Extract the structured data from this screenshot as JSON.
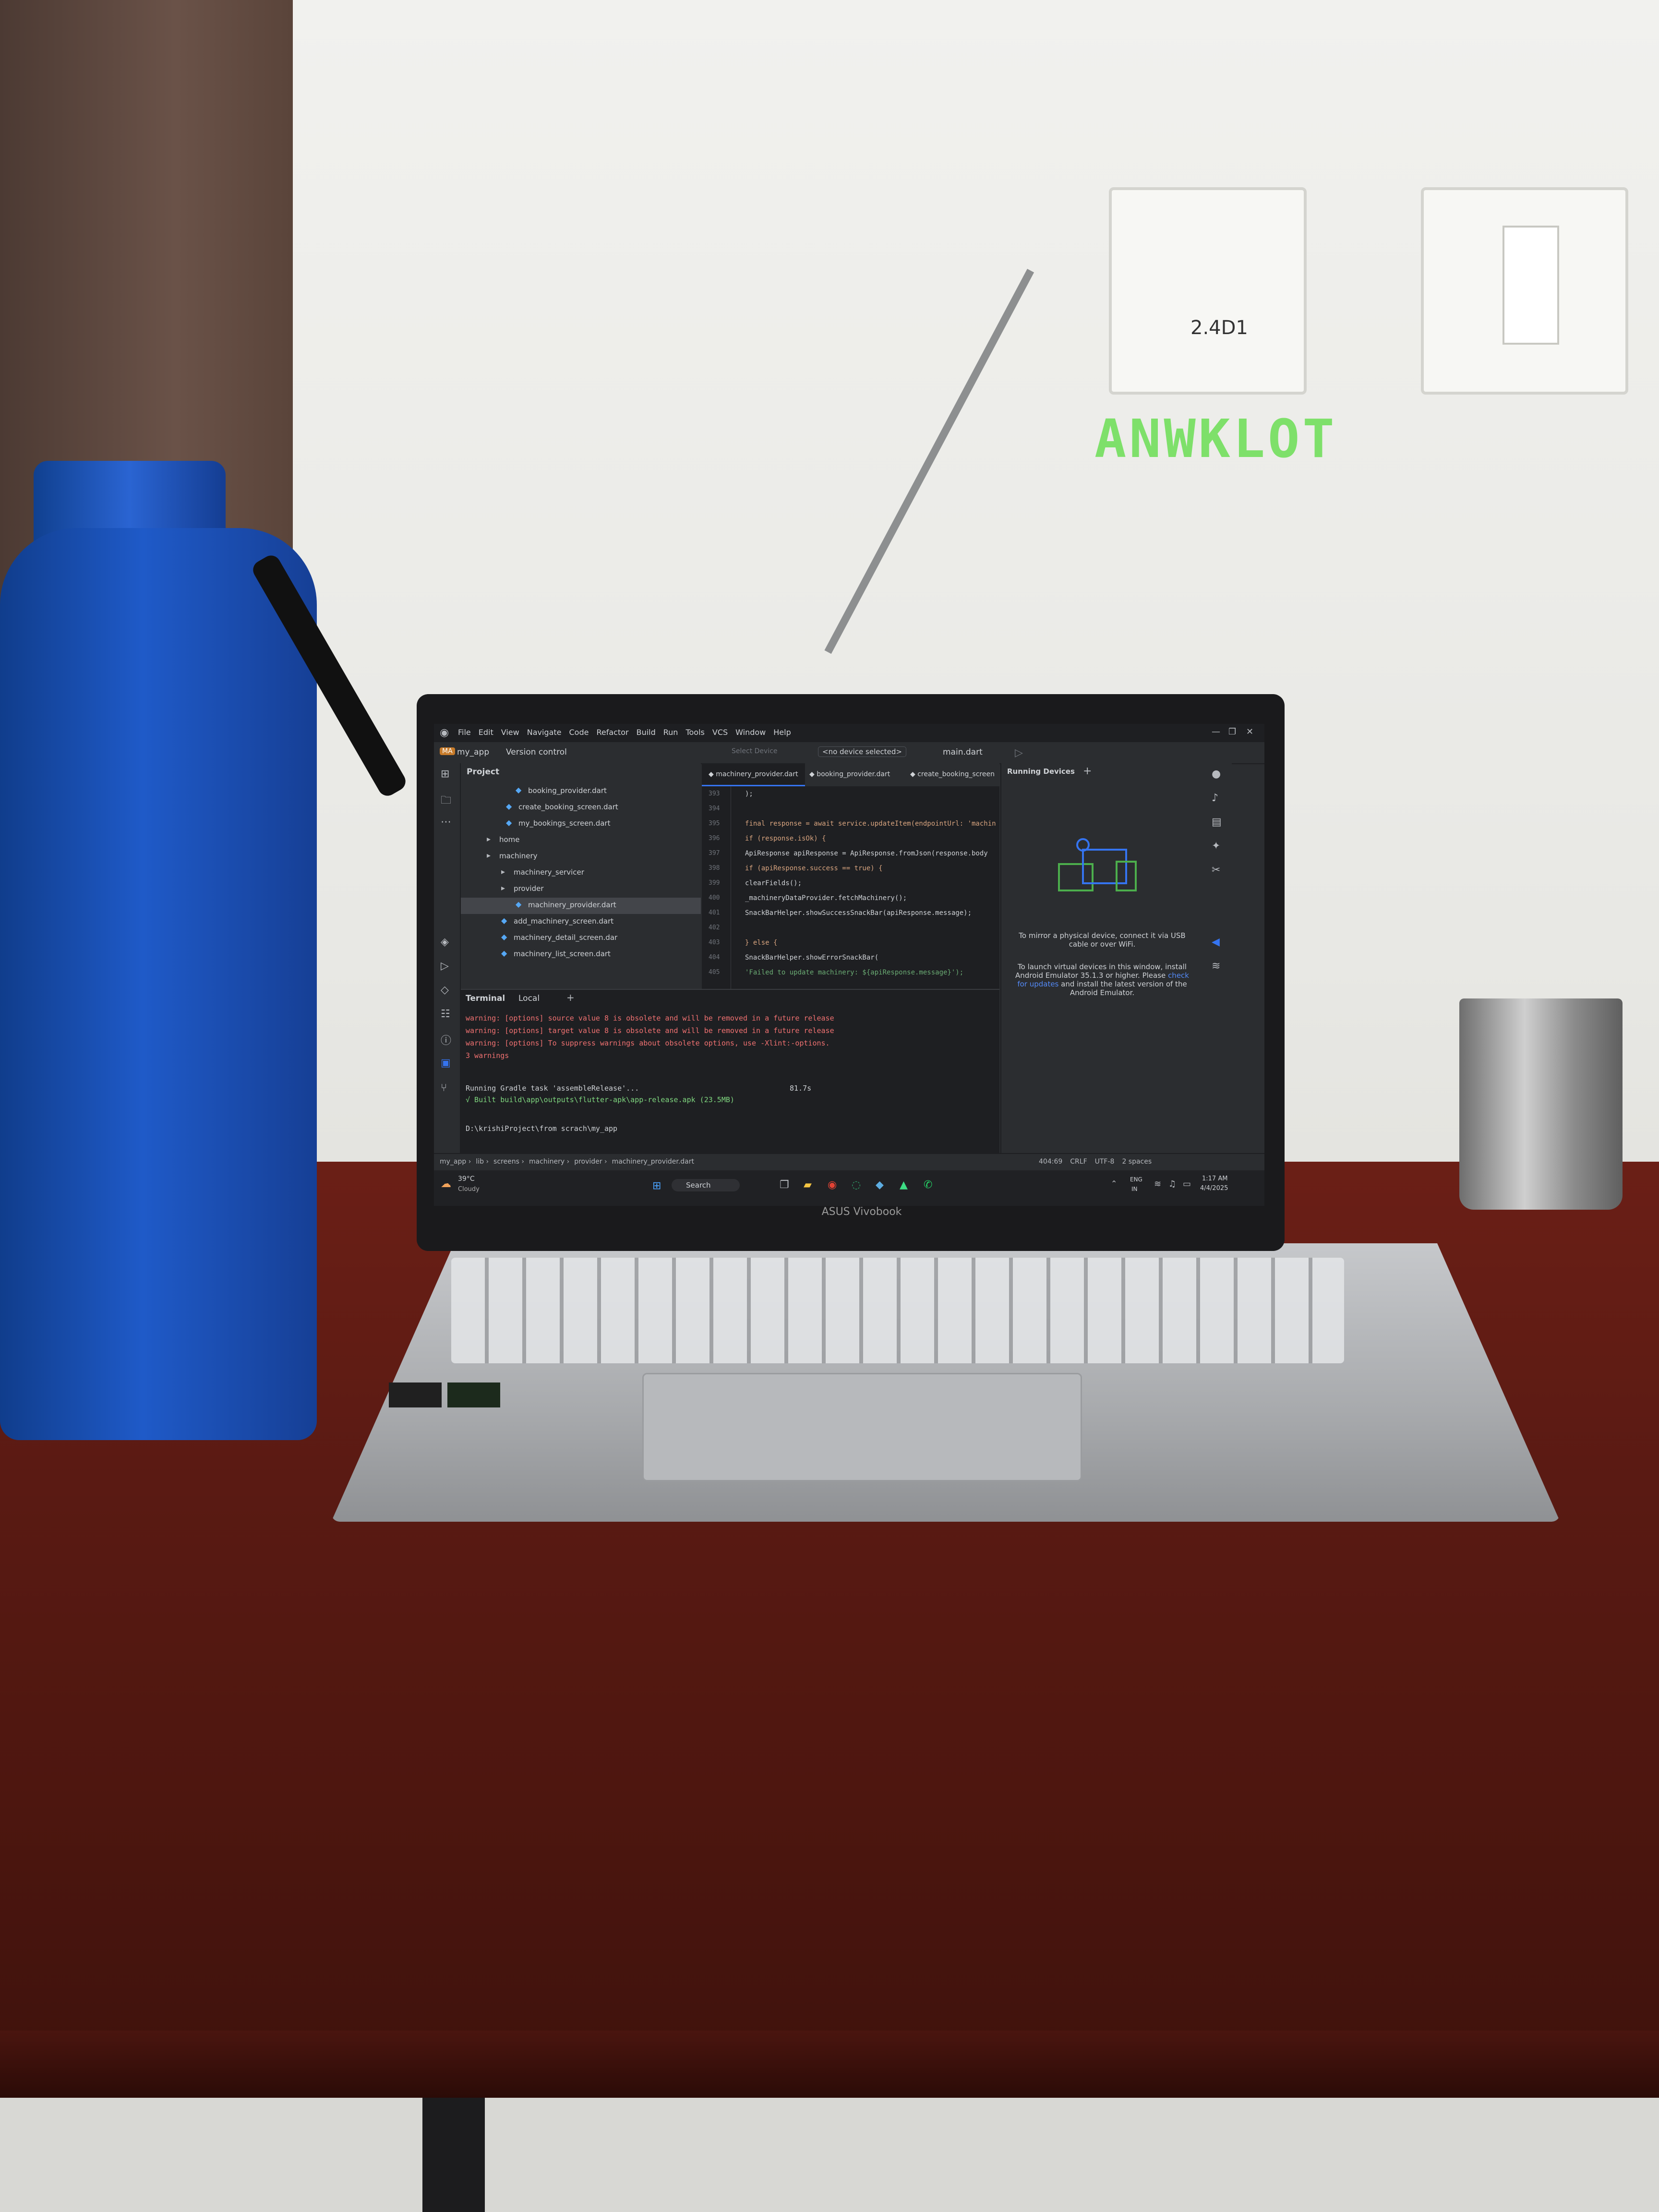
{
  "scene": {
    "socket_label": "2.4D1",
    "graffiti": "ANWKLOT",
    "laptop_brand": "ASUS Vivobook"
  },
  "ide": {
    "menu": [
      "File",
      "Edit",
      "View",
      "Navigate",
      "Code",
      "Refactor",
      "Build",
      "Run",
      "Tools",
      "VCS",
      "Window",
      "Help"
    ],
    "project_name": "my_app",
    "version_control": "Version control",
    "select_device": "Select Device",
    "device_dropdown": "<no device selected>",
    "run_config": "main.dart",
    "project_panel_title": "Project",
    "tree": [
      "booking_provider.dart",
      "create_booking_screen.dart",
      "my_bookings_screen.dart",
      "home",
      "machinery",
      "machinery_servicer",
      "provider",
      "machinery_provider.dart",
      "add_machinery_screen.dart",
      "machinery_detail_screen.dar",
      "machinery_list_screen.dart"
    ],
    "tabs": [
      "machinery_provider.dart",
      "booking_provider.dart",
      "create_booking_screen"
    ],
    "line_numbers": [
      "393",
      "394",
      "395",
      "396",
      "397",
      "398",
      "399",
      "400",
      "401",
      "402",
      "403",
      "404",
      "405"
    ],
    "code": [
      "  );",
      "",
      "  final response = await service.updateItem(endpointUrl: 'machin",
      "  if (response.isOk) {",
      "    ApiResponse apiResponse = ApiResponse.fromJson(response.body",
      "    if (apiResponse.success == true) {",
      "      clearFields();",
      "      _machineryDataProvider.fetchMachinery();",
      "      SnackBarHelper.showSuccessSnackBar(apiResponse.message);",
      "",
      "    } else {",
      "      SnackBarHelper.showErrorSnackBar(",
      "        'Failed to update machinery: ${apiResponse.message}');"
    ],
    "terminal": {
      "title": "Terminal",
      "tab": "Local",
      "lines_warn": [
        "warning: [options] source value 8 is obsolete and will be removed in a future release",
        "warning: [options] target value 8 is obsolete and will be removed in a future release",
        "warning: [options] To suppress warnings about obsolete options, use -Xlint:-options.",
        "3 warnings"
      ],
      "gradle_line": "Running Gradle task 'assembleRelease'...",
      "gradle_time": "81.7s",
      "built_line": "√ Built build\\app\\outputs\\flutter-apk\\app-release.apk (23.5MB)",
      "prompt": "D:\\krishiProject\\from scrach\\my_app"
    },
    "devices": {
      "title": "Running Devices",
      "line1": "To mirror a physical device, connect it via USB cable or over WiFi.",
      "line2": "To launch virtual devices in this window, install Android Emulator 35.1.3 or higher.",
      "line3_prefix": "Please",
      "line3_link": "check for updates",
      "line3_suffix": "and install the latest version of the Android Emulator."
    },
    "breadcrumb": [
      "my_app",
      "lib",
      "screens",
      "machinery",
      "provider",
      "machinery_provider.dart"
    ],
    "status_right": [
      "404:69",
      "CRLF",
      "UTF-8",
      "2 spaces"
    ],
    "taskbar": {
      "weather_temp": "39°C",
      "weather_desc": "Cloudy",
      "search": "Search",
      "lang": "ENG",
      "region": "IN",
      "time": "1:17 AM",
      "date": "4/4/2025"
    },
    "colors": {
      "accent": "#3574f0",
      "warn": "#f07171",
      "ok": "#7fd67f"
    }
  }
}
